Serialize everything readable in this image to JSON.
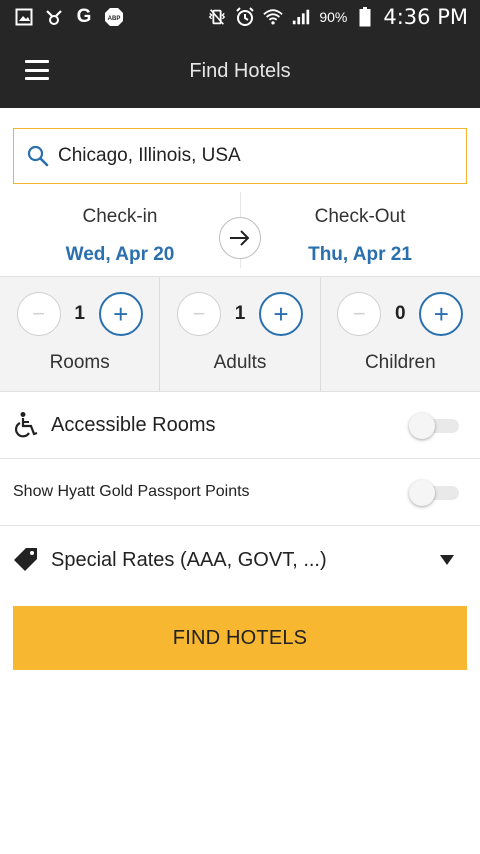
{
  "status_bar": {
    "battery_percent": "90%",
    "time": "4:36 PM"
  },
  "app_bar": {
    "title": "Find Hotels"
  },
  "search": {
    "value": "Chicago, Illinois, USA"
  },
  "dates": {
    "checkin_label": "Check-in",
    "checkin_value": "Wed, Apr 20",
    "checkout_label": "Check-Out",
    "checkout_value": "Thu, Apr 21"
  },
  "counters": [
    {
      "label": "Rooms",
      "value": "1",
      "minus": "−",
      "plus": "+"
    },
    {
      "label": "Adults",
      "value": "1",
      "minus": "−",
      "plus": "+"
    },
    {
      "label": "Children",
      "value": "0",
      "minus": "−",
      "plus": "+"
    }
  ],
  "options": {
    "accessible_label": "Accessible Rooms",
    "accessible_on": false,
    "gold_passport_label": "Show Hyatt Gold Passport Points",
    "gold_passport_on": false,
    "special_rates_label": "Special Rates (AAA, GOVT, ...)"
  },
  "actions": {
    "find_label": "FIND HOTELS"
  },
  "colors": {
    "accent_yellow": "#f7b731",
    "link_blue": "#2a6fae",
    "bar_dark": "#262626"
  }
}
